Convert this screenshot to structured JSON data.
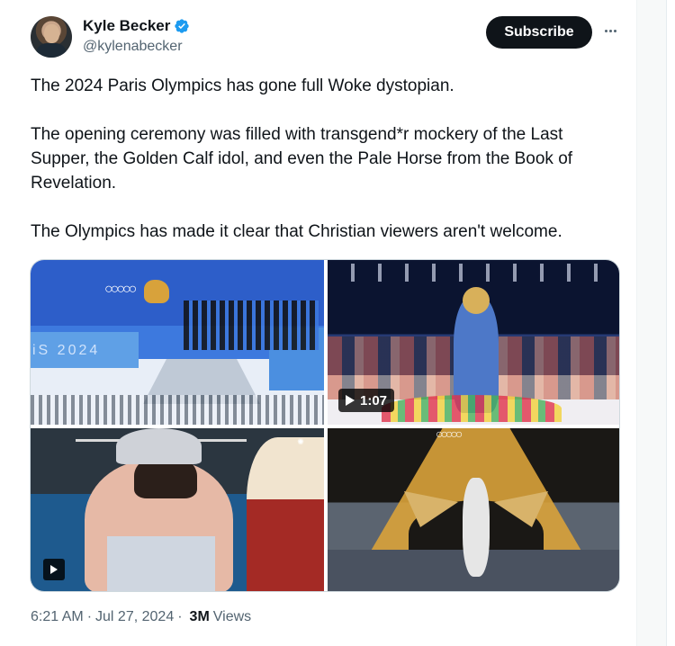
{
  "post": {
    "author": {
      "display_name": "Kyle Becker",
      "handle": "@kylenabecker",
      "verified": true,
      "verified_color": "#1d9bf0"
    },
    "subscribe_label": "Subscribe",
    "more_icon": "more-horizontal-icon",
    "paragraphs": [
      "The 2024 Paris Olympics has gone full Woke dystopian.",
      "The opening ceremony was filled with transgend*r mockery of the Last Supper, the Golden Calf idol, and even the Pale Horse from the Book of Revelation.",
      "The Olympics has made it clear that Christian viewers aren't welcome."
    ],
    "media": {
      "tiles": [
        {
          "kind": "image",
          "overlay_text": "iS 2024"
        },
        {
          "kind": "video",
          "duration": "1:07"
        },
        {
          "kind": "video"
        },
        {
          "kind": "image"
        }
      ]
    },
    "meta": {
      "time": "6:21 AM",
      "date": "Jul 27, 2024",
      "views_count": "3M",
      "views_label": "Views",
      "separator": "·"
    }
  },
  "colors": {
    "text_primary": "#0f1419",
    "text_secondary": "#536471",
    "button_bg": "#0f1419",
    "border": "#cfd9de"
  }
}
